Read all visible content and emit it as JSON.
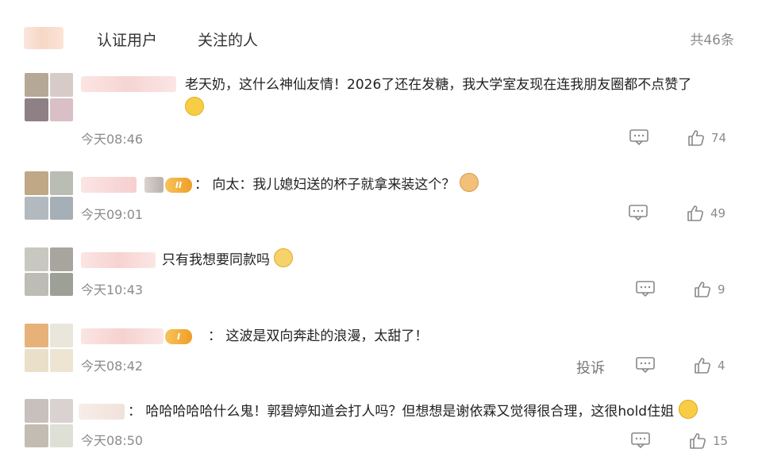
{
  "header": {
    "tabs": [
      "认证用户",
      "关注的人"
    ],
    "total": "共46条"
  },
  "comments": [
    {
      "text": "老天奶，这什么神仙友情！2026了还在发糖，我大学室友现在连我朋友圈都不点赞了",
      "time": "今天08:46",
      "likes": "74",
      "emoji": "smile-emoji"
    },
    {
      "text": "：  向太：我儿媳妇送的杯子就拿来装这个？",
      "time": "今天09:01",
      "likes": "49",
      "badge": "II",
      "emoji": "doge-emoji"
    },
    {
      "text": "只有我想要同款吗",
      "time": "今天10:43",
      "likes": "9",
      "emoji": "cry-emoji"
    },
    {
      "text": "：  这波是双向奔赴的浪漫，太甜了！",
      "time": "今天08:42",
      "likes": "4",
      "badge": "I",
      "report": "投诉"
    },
    {
      "text": "：  哈哈哈哈哈什么鬼！郭碧婷知道会打人吗？但想想是谢依霖又觉得很合理，这很hold住姐",
      "time": "今天08:50",
      "likes": "15",
      "emoji": "laugh-emoji"
    }
  ],
  "colors": {
    "text": "#222222",
    "muted": "#8b8b8b",
    "badge": "#ef9d27",
    "emoji": "#f6cd45"
  }
}
